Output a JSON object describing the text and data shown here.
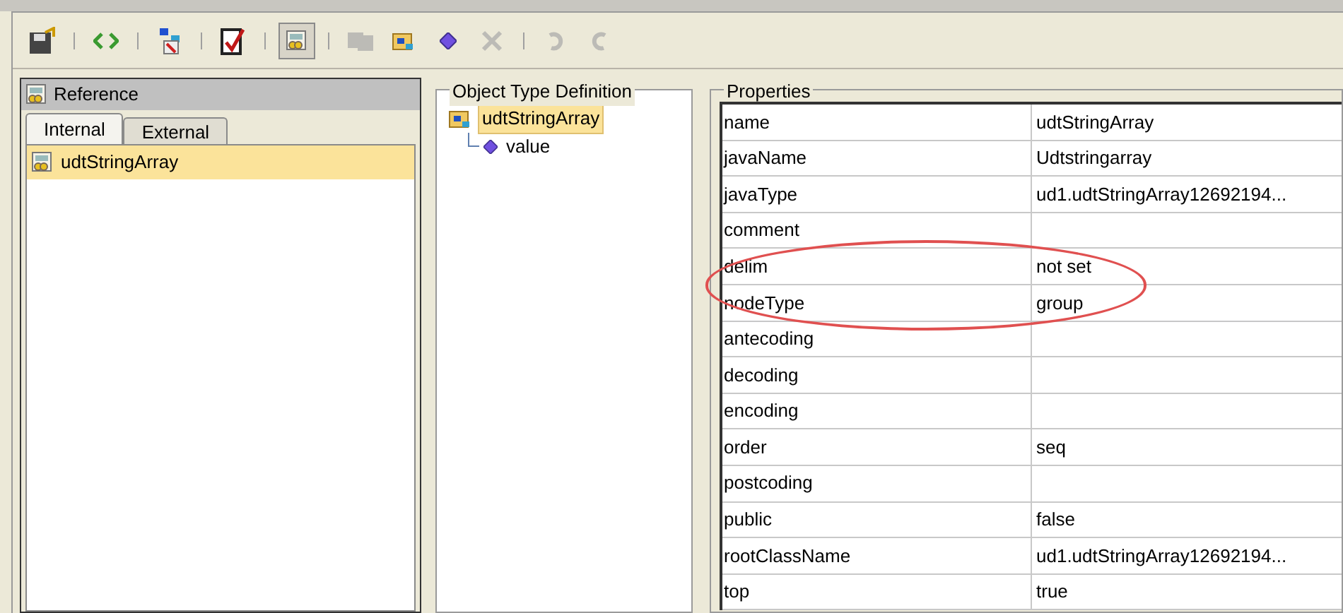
{
  "toolbar": [
    {
      "kind": "save",
      "disabled": false,
      "selected": false
    },
    {
      "kind": "separator"
    },
    {
      "kind": "code",
      "disabled": false,
      "selected": false
    },
    {
      "kind": "separator"
    },
    {
      "kind": "tree",
      "disabled": false,
      "selected": false
    },
    {
      "kind": "separator"
    },
    {
      "kind": "check",
      "disabled": false,
      "selected": false
    },
    {
      "kind": "separator"
    },
    {
      "kind": "reference",
      "disabled": false,
      "selected": true
    },
    {
      "kind": "separator"
    },
    {
      "kind": "copy",
      "disabled": true,
      "selected": false
    },
    {
      "kind": "folder",
      "disabled": false,
      "selected": false
    },
    {
      "kind": "diamond",
      "disabled": false,
      "selected": false
    },
    {
      "kind": "delete",
      "disabled": true,
      "selected": false
    },
    {
      "kind": "separator"
    },
    {
      "kind": "undo",
      "disabled": true,
      "selected": false
    },
    {
      "kind": "redo",
      "disabled": true,
      "selected": false
    }
  ],
  "reference": {
    "title": "Reference",
    "tabs": [
      {
        "label": "Internal",
        "selected": true
      },
      {
        "label": "External",
        "selected": false
      }
    ],
    "items": [
      {
        "label": "udtStringArray",
        "selected": true
      }
    ]
  },
  "object_type_definition": {
    "title": "Object Type Definition",
    "tree": [
      {
        "label": "udtStringArray",
        "selected": true,
        "children": [
          {
            "label": "value",
            "selected": false
          }
        ]
      }
    ]
  },
  "properties": {
    "title": "Properties",
    "rows": [
      {
        "name": "name",
        "value": "udtStringArray",
        "highlighted": false
      },
      {
        "name": "javaName",
        "value": "Udtstringarray",
        "highlighted": false
      },
      {
        "name": "javaType",
        "value": "ud1.udtStringArray12692194...",
        "highlighted": false
      },
      {
        "name": "comment",
        "highlighted": false
      },
      {
        "name": "delim",
        "value": "not set",
        "highlighted": true
      },
      {
        "name": "nodeType",
        "value": "group",
        "highlighted": true
      },
      {
        "name": "antecoding",
        "highlighted": false
      },
      {
        "name": "decoding",
        "highlighted": false
      },
      {
        "name": "encoding",
        "highlighted": false
      },
      {
        "name": "order",
        "value": "seq",
        "highlighted": false
      },
      {
        "name": "postcoding",
        "highlighted": false
      },
      {
        "name": "public",
        "value": "false",
        "highlighted": false
      },
      {
        "name": "rootClassName",
        "value": "ud1.udtStringArray12692194...",
        "highlighted": false
      },
      {
        "name": "top",
        "value": "true",
        "highlighted": false
      }
    ]
  }
}
